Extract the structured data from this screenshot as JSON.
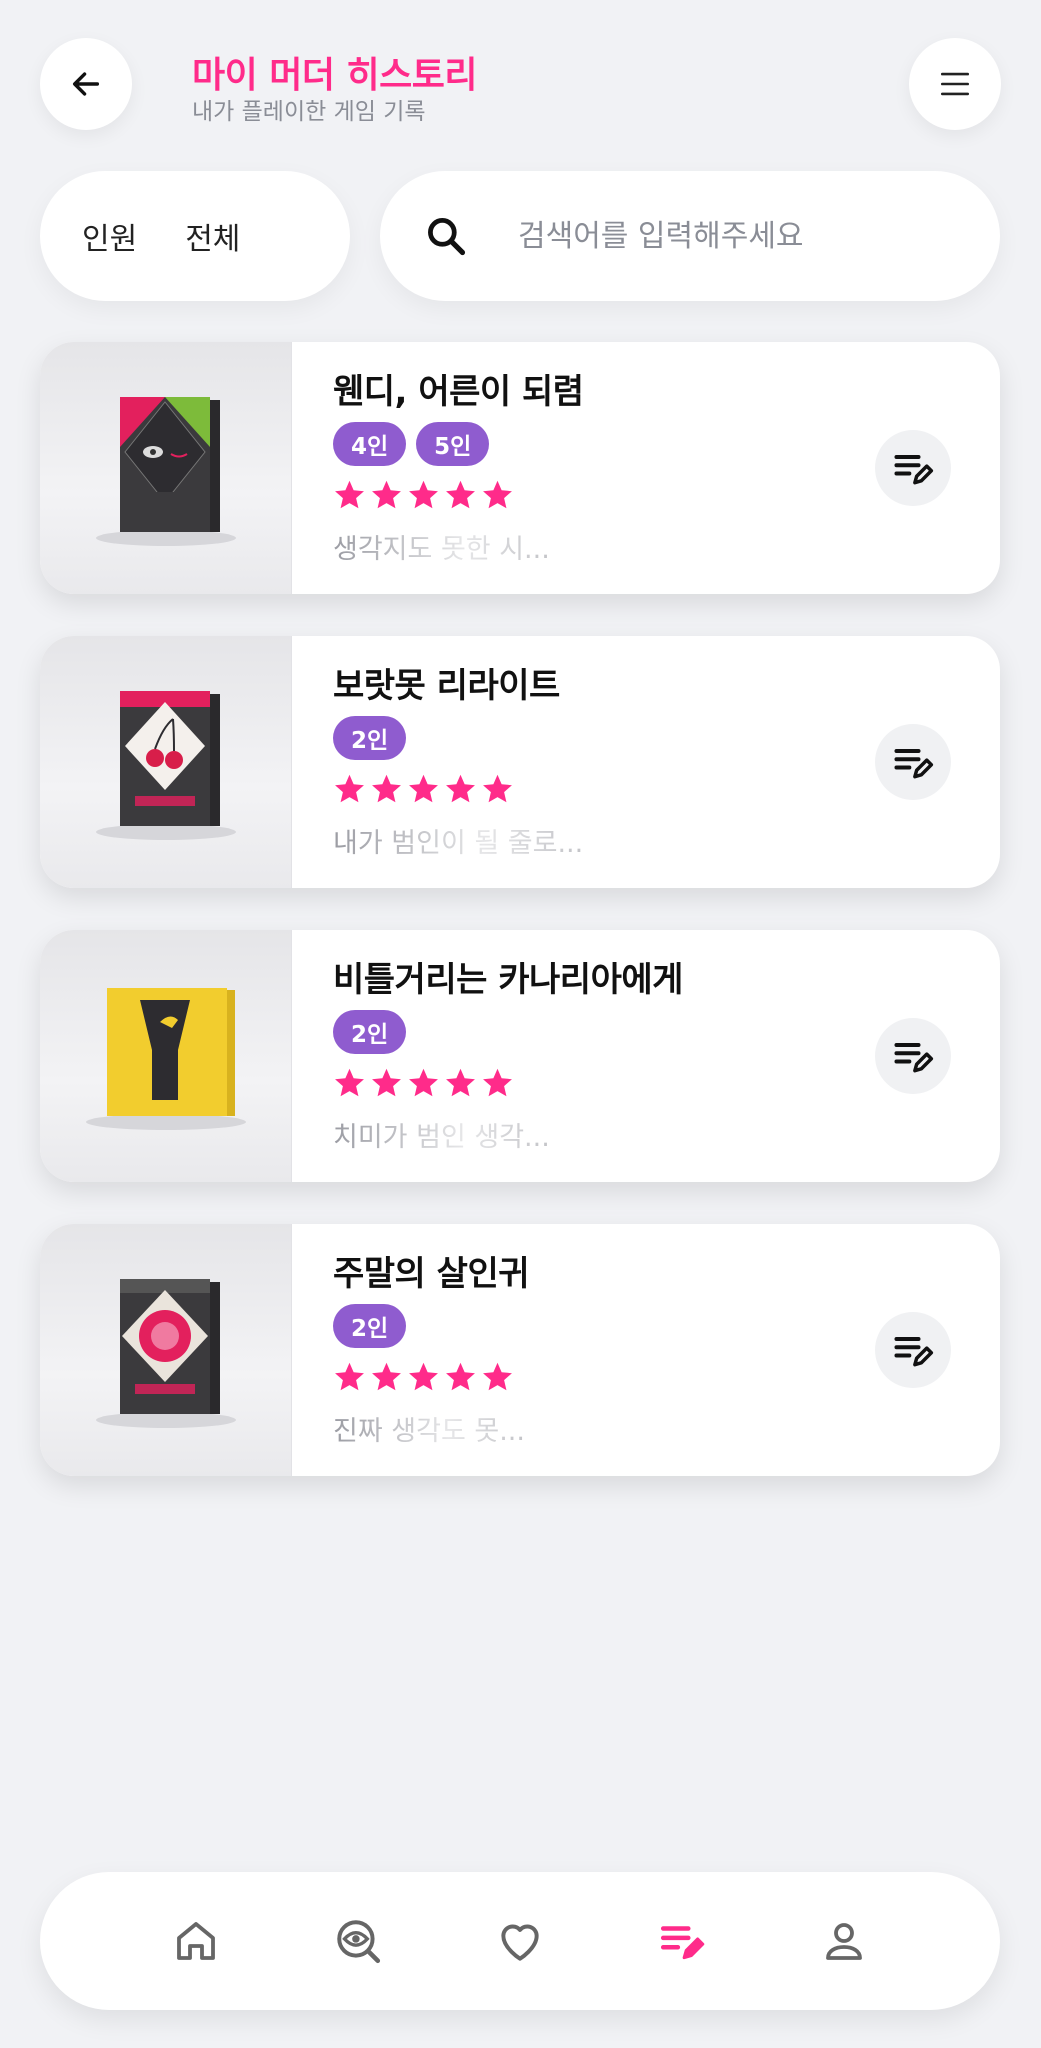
{
  "header": {
    "title": "마이 머더 히스토리",
    "subtitle": "내가 플레이한 게임 기록",
    "back_icon": "arrow-left-icon",
    "menu_icon": "hamburger-menu-icon"
  },
  "filter": {
    "label": "인원",
    "value": "전체"
  },
  "search": {
    "placeholder": "검색어를 입력해주세요",
    "value": ""
  },
  "colors": {
    "accent": "#ff2b8a",
    "badge": "#8f5ccf",
    "background": "#f1f2f5"
  },
  "games": [
    {
      "title": "웬디, 어른이 되렴",
      "players": [
        "4인",
        "5인"
      ],
      "rating": 5,
      "memo": "생각지도 못한 시..."
    },
    {
      "title": "보랏못 리라이트",
      "players": [
        "2인"
      ],
      "rating": 5,
      "memo": "내가 범인이 될 줄로..."
    },
    {
      "title": "비틀거리는 카나리아에게",
      "players": [
        "2인"
      ],
      "rating": 5,
      "memo": "치미가 범인 생각..."
    },
    {
      "title": "주말의 살인귀",
      "players": [
        "2인"
      ],
      "rating": 5,
      "memo": "진짜 생각도 못..."
    }
  ],
  "nav": {
    "items": [
      {
        "icon": "home-icon",
        "active": false
      },
      {
        "icon": "eye-search-icon",
        "active": false
      },
      {
        "icon": "heart-icon",
        "active": false
      },
      {
        "icon": "history-edit-icon",
        "active": true
      },
      {
        "icon": "user-icon",
        "active": false
      }
    ]
  }
}
